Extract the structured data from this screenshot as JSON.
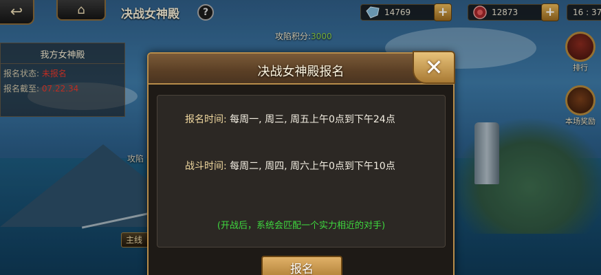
{
  "header": {
    "title": "决战女神殿",
    "help_symbol": "?",
    "back_symbol": "↩",
    "home_symbol": "⌂",
    "clock": "16 : 37"
  },
  "resources": [
    {
      "name": "crystal",
      "icon": "crystal-icon",
      "value": "14769",
      "plus": "+"
    },
    {
      "name": "gem",
      "icon": "gem-icon",
      "value": "12873",
      "plus": "+"
    }
  ],
  "side_buttons": [
    {
      "label": "排行",
      "icon": "ranking-icon"
    },
    {
      "label": "本场奖励",
      "icon": "treasure-chest-icon"
    }
  ],
  "left_panel": {
    "title": "我方女神殿",
    "status_label": "报名状态:",
    "status_value": "未报名",
    "deadline_label": "报名截至:",
    "deadline_value": "07.22.34"
  },
  "score": {
    "label": "攻陷积分:",
    "value": "3000"
  },
  "attack_label": "攻陷",
  "mainline_label": "主线",
  "modal": {
    "title": "决战女神殿报名",
    "close_symbol": "✕",
    "signup_time_label": "报名时间:",
    "signup_time_value": "每周一, 周三, 周五上午0点到下午24点",
    "battle_time_label": "战斗时间:",
    "battle_time_value": "每周二, 周四, 周六上午0点到下午10点",
    "note": "(开战后，系统会匹配一个实力相近的对手)",
    "signup_button": "报名"
  },
  "colors": {
    "status_red": "#e6382b",
    "score_green": "#8fd44a",
    "note_green": "#3fd83f",
    "gold_border": "#b98d4a"
  }
}
